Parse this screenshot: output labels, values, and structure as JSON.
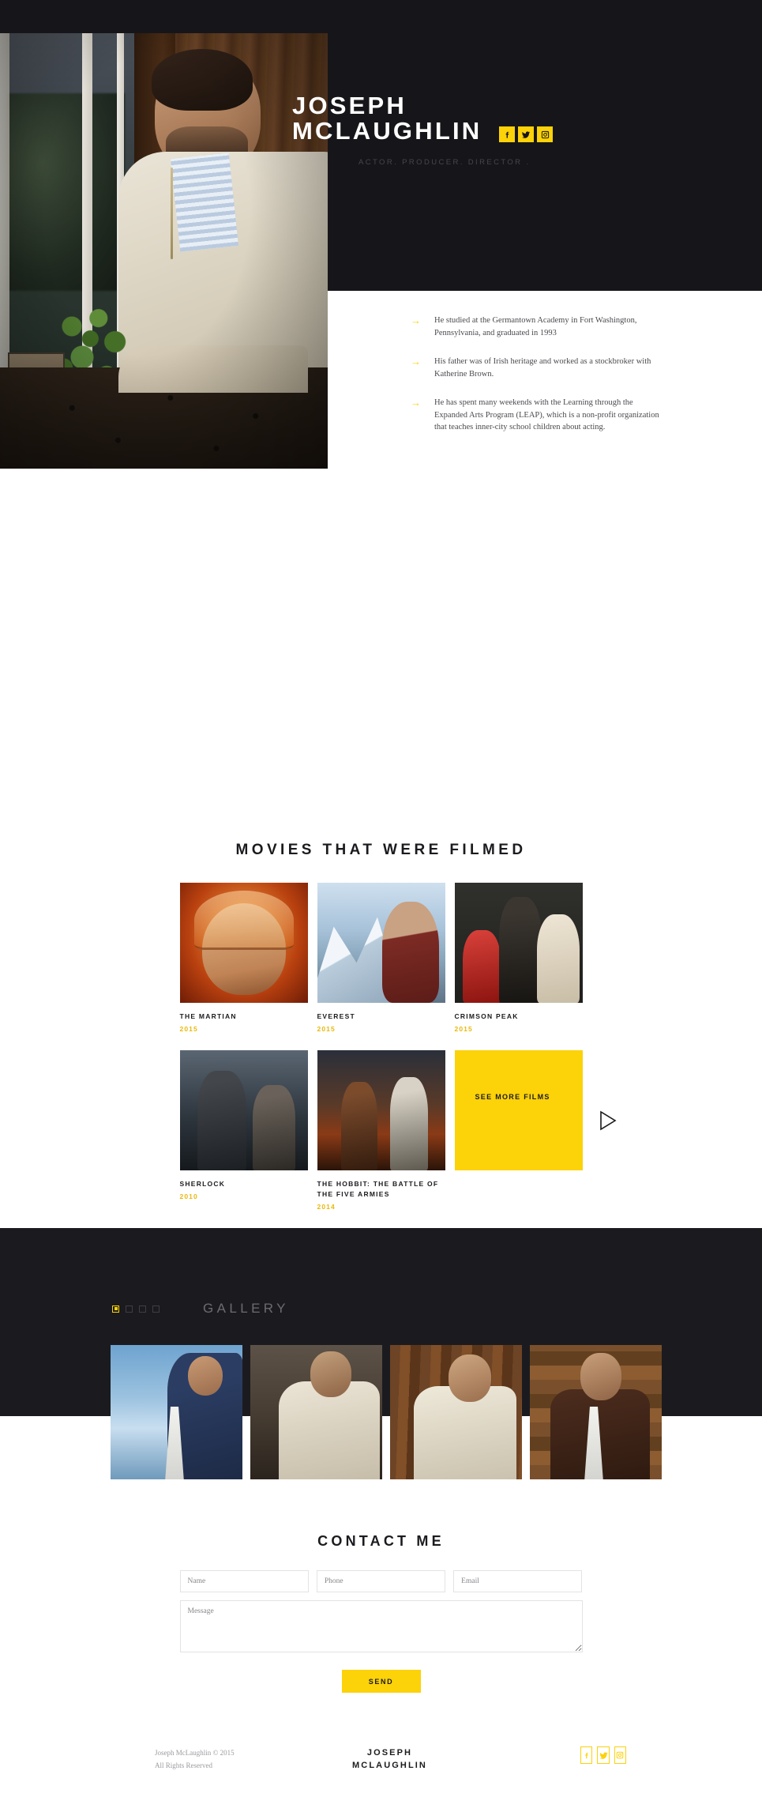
{
  "hero": {
    "name_line1": "JOSEPH",
    "name_line2": "MCLAUGHLIN",
    "subtitle": "ACTOR.  PRODUCER.  DIRECTOR  .",
    "socials": [
      {
        "name": "facebook",
        "glyph": "f"
      },
      {
        "name": "twitter",
        "glyph": "t"
      },
      {
        "name": "instagram",
        "glyph": "i"
      }
    ],
    "accent_color": "#fcd209",
    "dark_color": "#16161a"
  },
  "bio": {
    "items": [
      {
        "arrow": "→",
        "text": "He studied at the Germantown Academy in Fort Washington, Pennsylvania, and graduated in 1993"
      },
      {
        "arrow": "→",
        "text": "His father was of Irish heritage and worked as a stockbroker with Katherine Brown."
      },
      {
        "arrow": "→",
        "text": "He has spent many weekends with the Learning through the Expanded Arts Program (LEAP), which is a non-profit organization that teaches inner-city school children about acting."
      }
    ]
  },
  "movies": {
    "title": "MOVIES THAT WERE FILMED",
    "items": [
      {
        "title": "THE MARTIAN",
        "year": "2015",
        "art": "p-martian"
      },
      {
        "title": "EVEREST",
        "year": "2015",
        "art": "p-everest"
      },
      {
        "title": "CRIMSON PEAK",
        "year": "2015",
        "art": "p-crimson"
      },
      {
        "title": "SHERLOCK",
        "year": "2010",
        "art": "p-sherlock"
      },
      {
        "title": "THE HOBBIT: THE BATTLE OF THE FIVE ARMIES",
        "year": "2014",
        "art": "p-hobbit"
      }
    ],
    "see_more_label": "SEE MORE FILMS"
  },
  "gallery": {
    "title": "GALLERY",
    "dots": [
      {
        "active": true
      },
      {
        "active": false
      },
      {
        "active": false
      },
      {
        "active": false
      }
    ],
    "images": [
      {
        "alt": "man-in-navy-suit-sky"
      },
      {
        "alt": "man-in-cream-jacket-stone-wall"
      },
      {
        "alt": "man-in-cream-jacket-wood-wall"
      },
      {
        "alt": "man-in-brown-suit-wood-wall"
      }
    ]
  },
  "contact": {
    "title": "CONTACT ME",
    "name_placeholder": "Name",
    "phone_placeholder": "Phone",
    "email_placeholder": "Email",
    "message_placeholder": "Message",
    "name_value": "",
    "phone_value": "",
    "email_value": "",
    "message_value": "",
    "send_label": "SEND"
  },
  "footer": {
    "copyright_line1": "Joseph McLaughlin © 2015",
    "copyright_line2": "All Rights Reserved",
    "logo_line1": "JOSEPH",
    "logo_line2": "MCLAUGHLIN",
    "socials": [
      {
        "name": "facebook",
        "glyph": "f"
      },
      {
        "name": "twitter",
        "glyph": "t"
      },
      {
        "name": "instagram",
        "glyph": "i"
      }
    ]
  }
}
